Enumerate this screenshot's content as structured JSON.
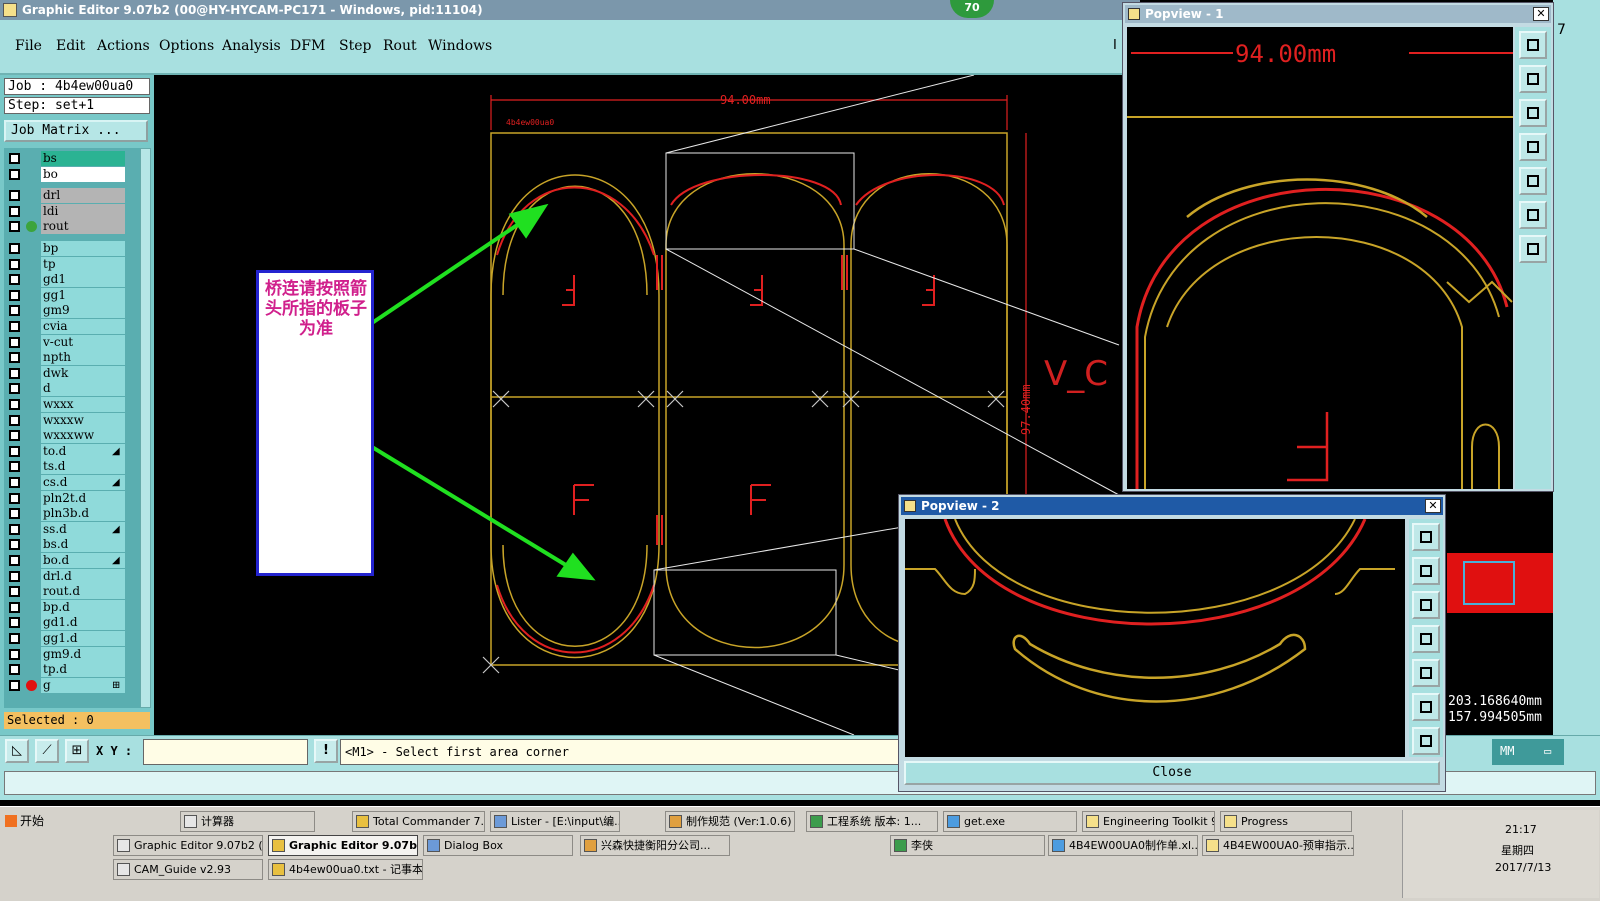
{
  "window": {
    "title": "Graphic Editor 9.07b2 (00@HY-HYCAM-PC171 - Windows, pid:11104)",
    "badge": "70"
  },
  "menu": [
    "File",
    "Edit",
    "Actions",
    "Options",
    "Analysis",
    "DFM",
    "Step",
    "Rout",
    "Windows"
  ],
  "job": {
    "job_line": "Job : 4b4ew00ua0",
    "step_line": "Step: set+1",
    "matrix_button": "Job Matrix ..."
  },
  "layers": [
    {
      "name": "bs",
      "color": "#2bb393",
      "dot": ""
    },
    {
      "name": "bo",
      "color": "#ffffff",
      "dot": ""
    },
    {
      "name": "drl",
      "color": "#b4b4b4",
      "dot": ""
    },
    {
      "name": "ldi",
      "color": "#b4b4b4",
      "dot": ""
    },
    {
      "name": "rout",
      "color": "#b4b4b4",
      "dot": "#3ca43c"
    },
    {
      "name": "bp",
      "color": "#8fdada",
      "dot": ""
    },
    {
      "name": "tp",
      "color": "#8fdada",
      "dot": ""
    },
    {
      "name": "gd1",
      "color": "#8fdada",
      "dot": ""
    },
    {
      "name": "gg1",
      "color": "#8fdada",
      "dot": ""
    },
    {
      "name": "gm9",
      "color": "#8fdada",
      "dot": ""
    },
    {
      "name": "cvia",
      "color": "#8fdada",
      "dot": ""
    },
    {
      "name": "v-cut",
      "color": "#8fdada",
      "dot": ""
    },
    {
      "name": "npth",
      "color": "#8fdada",
      "dot": ""
    },
    {
      "name": "dwk",
      "color": "#8fdada",
      "dot": ""
    },
    {
      "name": "d",
      "color": "#8fdada",
      "dot": ""
    },
    {
      "name": "wxxx",
      "color": "#8fdada",
      "dot": ""
    },
    {
      "name": "wxxxw",
      "color": "#8fdada",
      "dot": ""
    },
    {
      "name": "wxxxww",
      "color": "#8fdada",
      "dot": ""
    },
    {
      "name": "to.d",
      "color": "#8fdada",
      "dot": "",
      "mark": "◢"
    },
    {
      "name": "ts.d",
      "color": "#8fdada",
      "dot": ""
    },
    {
      "name": "cs.d",
      "color": "#8fdada",
      "dot": "",
      "mark": "◢"
    },
    {
      "name": "pln2t.d",
      "color": "#8fdada",
      "dot": ""
    },
    {
      "name": "pln3b.d",
      "color": "#8fdada",
      "dot": ""
    },
    {
      "name": "ss.d",
      "color": "#8fdada",
      "dot": "",
      "mark": "◢"
    },
    {
      "name": "bs.d",
      "color": "#8fdada",
      "dot": ""
    },
    {
      "name": "bo.d",
      "color": "#8fdada",
      "dot": "",
      "mark": "◢"
    },
    {
      "name": "drl.d",
      "color": "#8fdada",
      "dot": ""
    },
    {
      "name": "rout.d",
      "color": "#8fdada",
      "dot": ""
    },
    {
      "name": "bp.d",
      "color": "#8fdada",
      "dot": ""
    },
    {
      "name": "gd1.d",
      "color": "#8fdada",
      "dot": ""
    },
    {
      "name": "gg1.d",
      "color": "#8fdada",
      "dot": ""
    },
    {
      "name": "gm9.d",
      "color": "#8fdada",
      "dot": ""
    },
    {
      "name": "tp.d",
      "color": "#8fdada",
      "dot": ""
    },
    {
      "name": "g",
      "color": "#8fdada",
      "dot": "#e01010",
      "mark": "⊞"
    }
  ],
  "selected_label": "Selected : 0",
  "canvas": {
    "dim_width": "94.00mm",
    "dim_height": "97.40mm",
    "top_label": "4b4ew00ua0",
    "vcut_label": "V_C",
    "annotation": "桥连请按照箭头所指的板子为准"
  },
  "popview1": {
    "title": "Popview - 1",
    "dim": "94.00mm"
  },
  "popview2": {
    "title": "Popview - 2",
    "close_label": "Close"
  },
  "command": {
    "xy_label": "X Y :",
    "xy_value": "",
    "prompt": "<M1> - Select first area corner"
  },
  "coords": {
    "x": "203.168640mm",
    "y": "157.994505mm"
  },
  "units": "MM",
  "corner_marks": [
    "7",
    "I"
  ],
  "taskbar": {
    "start": "开始",
    "tasks_row1": [
      "计算器",
      "Total Commander 7....",
      "Lister - [E:\\input\\编...",
      "制作规范 (Ver:1.0.6)",
      "工程系统 版本: 1...",
      "get.exe",
      "Engineering Toolkit 9...",
      "Progress"
    ],
    "tasks_row2": [
      "Graphic Editor 9.07b2 (0...",
      "Graphic Editor 9.07b2...",
      "Dialog Box",
      "兴森快捷衡阳分公司...",
      "李侠",
      "4B4EW00UA0制作单.xl...",
      "4B4EW00UA0-预审指示..."
    ],
    "tasks_row3": [
      "CAM_Guide v2.93",
      "4b4ew00ua0.txt - 记事本"
    ],
    "clock": "21:17",
    "weekday": "星期四",
    "date": "2017/7/13"
  }
}
